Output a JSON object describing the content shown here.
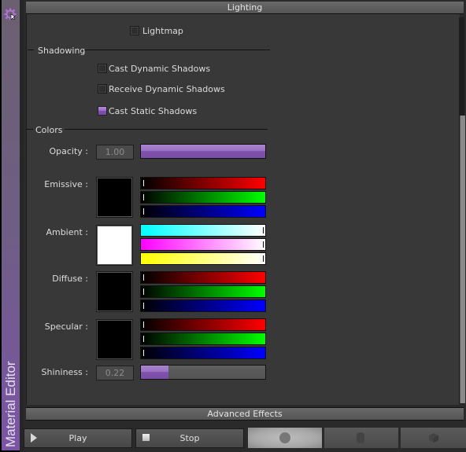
{
  "sidebar": {
    "title": "Material Editor",
    "icon": "gear-icon"
  },
  "lighting": {
    "header": "Lighting",
    "lightmap": {
      "label": "Lightmap",
      "checked": false
    }
  },
  "shadowing": {
    "title": "Shadowing",
    "options": [
      {
        "label": "Cast Dynamic Shadows",
        "checked": false
      },
      {
        "label": "Receive Dynamic Shadows",
        "checked": false
      },
      {
        "label": "Cast Static Shadows",
        "checked": true
      }
    ]
  },
  "colors": {
    "title": "Colors",
    "opacity": {
      "label": "Opacity :",
      "value": "1.00",
      "fraction": 1.0
    },
    "emissive": {
      "label": "Emissive :",
      "swatch": "#000000",
      "rgb": [
        0,
        0,
        0
      ]
    },
    "ambient": {
      "label": "Ambient :",
      "swatch": "#ffffff",
      "rgb": [
        1,
        1,
        1
      ]
    },
    "diffuse": {
      "label": "Diffuse :",
      "swatch": "#000000",
      "rgb": [
        0,
        0,
        0
      ]
    },
    "specular": {
      "label": "Specular :",
      "swatch": "#000000",
      "rgb": [
        0,
        0,
        0
      ]
    },
    "shininess": {
      "label": "Shininess :",
      "value": "0.22",
      "fraction": 0.22
    }
  },
  "advanced": {
    "header": "Advanced Effects"
  },
  "toolbar": {
    "play_label": "Play",
    "stop_label": "Stop",
    "preview_shapes": [
      "sphere",
      "cylinder",
      "cube"
    ],
    "active_shape": "sphere"
  },
  "theme": {
    "accent": "#8a5cbb",
    "panel_bg": "#383838"
  }
}
